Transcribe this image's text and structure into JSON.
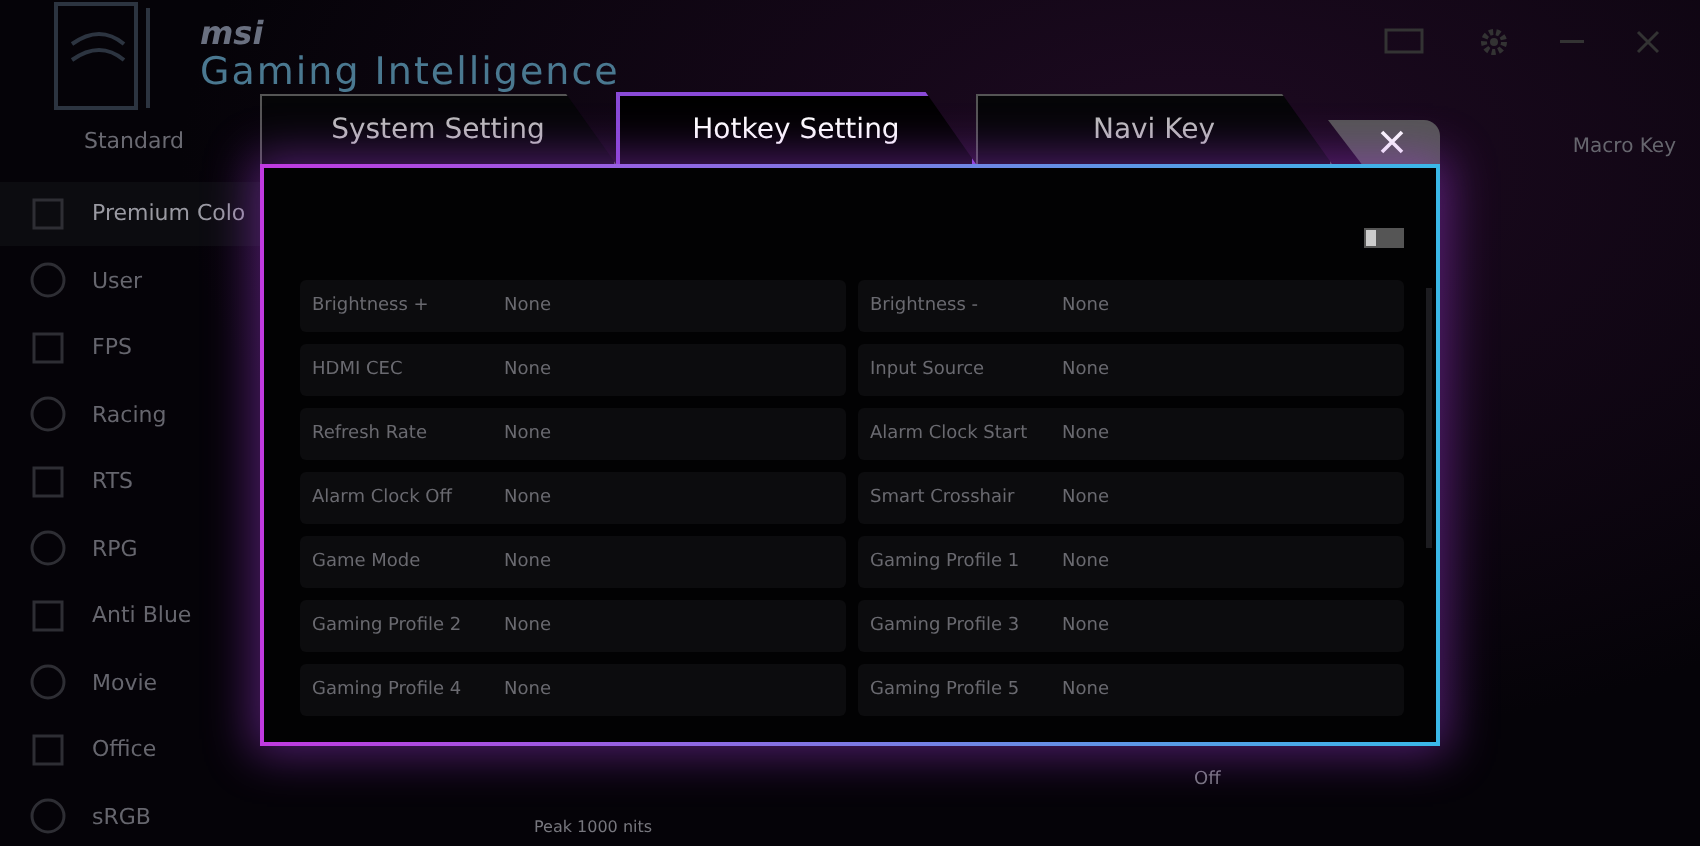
{
  "app": {
    "brand": "msi",
    "title": "Gaming Intelligence",
    "mode_tab": "Standard",
    "right_tab": "Macro Key",
    "footer_note": "Peak 1000 nits",
    "footer_value": "Off"
  },
  "sidebar": {
    "items": [
      {
        "label": "Premium Colo",
        "selected": true
      },
      {
        "label": "User",
        "selected": false
      },
      {
        "label": "FPS",
        "selected": false
      },
      {
        "label": "Racing",
        "selected": false
      },
      {
        "label": "RTS",
        "selected": false
      },
      {
        "label": "RPG",
        "selected": false
      },
      {
        "label": "Anti Blue",
        "selected": false
      },
      {
        "label": "Movie",
        "selected": false
      },
      {
        "label": "Office",
        "selected": false
      },
      {
        "label": "sRGB",
        "selected": false
      }
    ]
  },
  "dialog": {
    "tabs": [
      {
        "label": "System Setting",
        "selected": false
      },
      {
        "label": "Hotkey Setting",
        "selected": true
      },
      {
        "label": "Navi Key",
        "selected": false
      }
    ],
    "toggle": {
      "on": false
    },
    "hotkeys": [
      {
        "name": "Brightness +",
        "value": "None"
      },
      {
        "name": "Brightness -",
        "value": "None"
      },
      {
        "name": "HDMI CEC",
        "value": "None"
      },
      {
        "name": "Input Source",
        "value": "None"
      },
      {
        "name": "Refresh Rate",
        "value": "None"
      },
      {
        "name": "Alarm Clock Start",
        "value": "None"
      },
      {
        "name": "Alarm Clock Off",
        "value": "None"
      },
      {
        "name": "Smart Crosshair",
        "value": "None"
      },
      {
        "name": "Game Mode",
        "value": "None"
      },
      {
        "name": "Gaming Profile 1",
        "value": "None"
      },
      {
        "name": "Gaming Profile 2",
        "value": "None"
      },
      {
        "name": "Gaming Profile 3",
        "value": "None"
      },
      {
        "name": "Gaming Profile 4",
        "value": "None"
      },
      {
        "name": "Gaming Profile 5",
        "value": "None"
      }
    ]
  }
}
